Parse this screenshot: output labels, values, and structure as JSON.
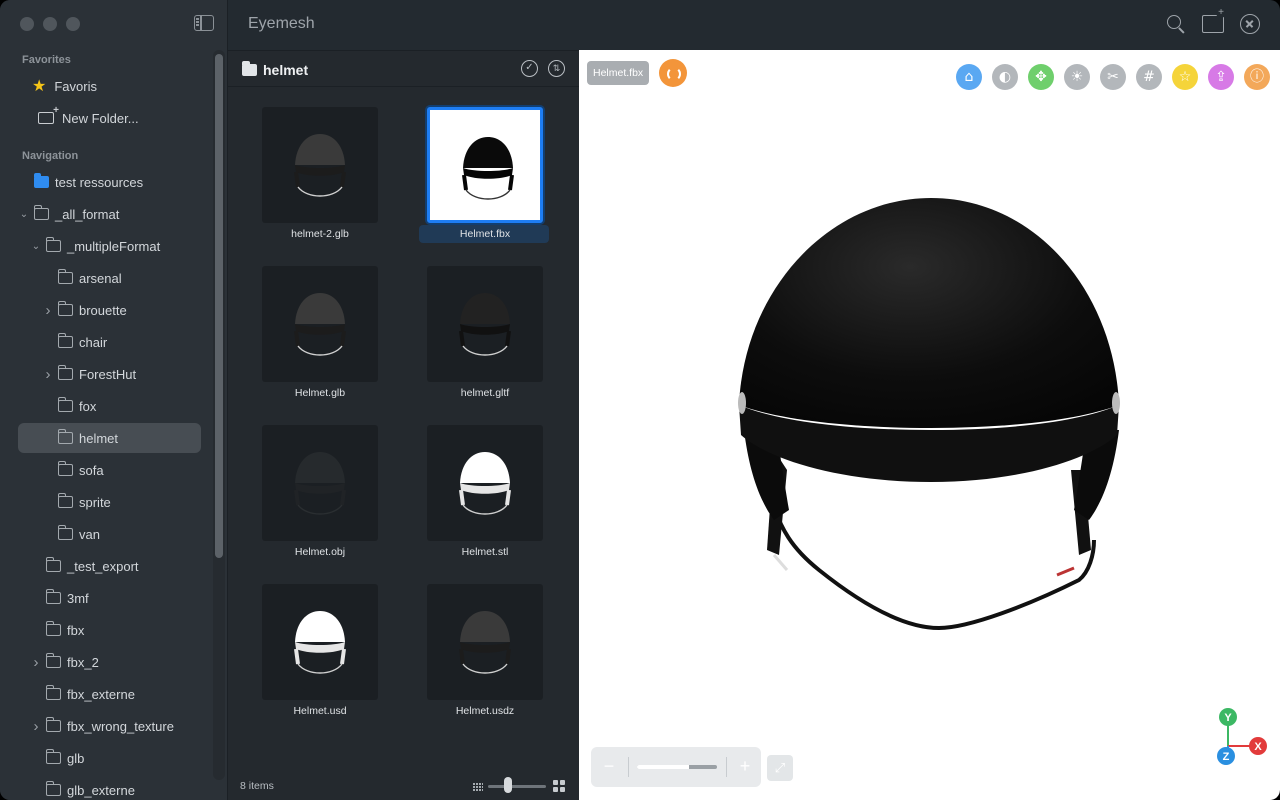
{
  "app": {
    "title": "Eyemesh"
  },
  "sidebar": {
    "favorites_title": "Favorites",
    "favorites": [
      {
        "label": "Favoris",
        "icon": "star-icon"
      },
      {
        "label": "New Folder...",
        "icon": "new-folder-icon"
      }
    ],
    "navigation_title": "Navigation",
    "items": [
      {
        "label": "test ressources",
        "depth": 0,
        "chevron": "",
        "icon": "folder-blue-icon"
      },
      {
        "label": "_all_format",
        "depth": 0,
        "chevron": "down",
        "icon": "folder-icon"
      },
      {
        "label": "_multipleFormat",
        "depth": 1,
        "chevron": "down",
        "icon": "folder-icon"
      },
      {
        "label": "arsenal",
        "depth": 2,
        "chevron": "",
        "icon": "folder-icon"
      },
      {
        "label": "brouette",
        "depth": 2,
        "chevron": "right",
        "icon": "folder-icon"
      },
      {
        "label": "chair",
        "depth": 2,
        "chevron": "",
        "icon": "folder-icon"
      },
      {
        "label": "ForestHut",
        "depth": 2,
        "chevron": "right",
        "icon": "folder-icon"
      },
      {
        "label": "fox",
        "depth": 2,
        "chevron": "",
        "icon": "folder-icon"
      },
      {
        "label": "helmet",
        "depth": 2,
        "chevron": "",
        "icon": "folder-icon",
        "selected": true
      },
      {
        "label": "sofa",
        "depth": 2,
        "chevron": "",
        "icon": "folder-icon"
      },
      {
        "label": "sprite",
        "depth": 2,
        "chevron": "",
        "icon": "folder-icon"
      },
      {
        "label": "van",
        "depth": 2,
        "chevron": "",
        "icon": "folder-icon"
      },
      {
        "label": "_test_export",
        "depth": 1,
        "chevron": "",
        "icon": "folder-icon"
      },
      {
        "label": "3mf",
        "depth": 1,
        "chevron": "",
        "icon": "folder-icon"
      },
      {
        "label": "fbx",
        "depth": 1,
        "chevron": "",
        "icon": "folder-icon"
      },
      {
        "label": "fbx_2",
        "depth": 1,
        "chevron": "right",
        "icon": "folder-icon"
      },
      {
        "label": "fbx_externe",
        "depth": 1,
        "chevron": "",
        "icon": "folder-icon"
      },
      {
        "label": "fbx_wrong_texture",
        "depth": 1,
        "chevron": "right",
        "icon": "folder-icon"
      },
      {
        "label": "glb",
        "depth": 1,
        "chevron": "",
        "icon": "folder-icon"
      },
      {
        "label": "glb_externe",
        "depth": 1,
        "chevron": "",
        "icon": "folder-icon"
      }
    ]
  },
  "browser": {
    "folder_title": "helmet",
    "items_count": "8 items",
    "thumbnail_size": 0.35,
    "files": [
      {
        "name": "helmet-2.glb",
        "style": "dark-matte"
      },
      {
        "name": "Helmet.fbx",
        "style": "black-on-white",
        "selected": true
      },
      {
        "name": "Helmet.glb",
        "style": "dark-matte"
      },
      {
        "name": "helmet.gltf",
        "style": "dark-glossy"
      },
      {
        "name": "Helmet.obj",
        "style": "dim"
      },
      {
        "name": "Helmet.stl",
        "style": "white"
      },
      {
        "name": "Helmet.usd",
        "style": "white"
      },
      {
        "name": "Helmet.usdz",
        "style": "dark-matte"
      }
    ]
  },
  "viewer": {
    "file_chip": "Helmet.fbx",
    "toolbar": [
      {
        "icon": "home-icon",
        "color": "#5aa8f2",
        "glyph": "⌂"
      },
      {
        "icon": "contrast-icon",
        "color": "#b3b7bb",
        "glyph": "◐"
      },
      {
        "icon": "model-icon",
        "color": "#6fcf6c",
        "glyph": "✥"
      },
      {
        "icon": "light-icon",
        "color": "#b3b7bb",
        "glyph": "☀"
      },
      {
        "icon": "scissors-icon",
        "color": "#b3b7bb",
        "glyph": "✂"
      },
      {
        "icon": "grid-icon",
        "color": "#b3b7bb",
        "glyph": "#"
      },
      {
        "icon": "star-icon",
        "color": "#f5d43a",
        "glyph": "☆"
      },
      {
        "icon": "share-icon",
        "color": "#d77ae6",
        "glyph": "⇪"
      },
      {
        "icon": "info-icon",
        "color": "#f3a85a",
        "glyph": "ⓘ"
      }
    ],
    "zoom": {
      "minus": "−",
      "plus": "+",
      "level": 0.65
    },
    "axes": {
      "x": "X",
      "y": "Y",
      "z": "Z"
    },
    "colors": {
      "accent": "#1e7df3",
      "refresh": "#f3953a"
    }
  }
}
